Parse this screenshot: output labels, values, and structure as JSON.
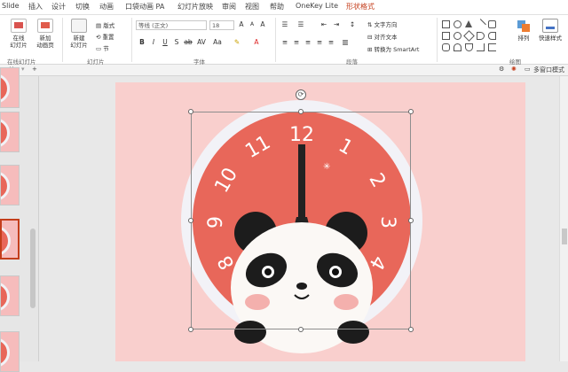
{
  "tabs": [
    {
      "label": "Slide",
      "active": false
    },
    {
      "label": "插入",
      "active": false
    },
    {
      "label": "设计",
      "active": false
    },
    {
      "label": "切换",
      "active": false
    },
    {
      "label": "动画",
      "active": false
    },
    {
      "label": "口袋动画 PA",
      "active": false
    },
    {
      "label": "幻灯片放映",
      "active": false
    },
    {
      "label": "审阅",
      "active": false
    },
    {
      "label": "视图",
      "active": false
    },
    {
      "label": "帮助",
      "active": false
    },
    {
      "label": "OneKey Lite",
      "active": false
    },
    {
      "label": "形状格式",
      "active": true
    }
  ],
  "ribbon": {
    "online_slide": "在线\n幻灯片",
    "new_animation": "新加\n动画页",
    "new_slide": "新建\n幻灯片",
    "layout": "版式",
    "reset": "重置",
    "section": "节",
    "font_name": "等线 (正文)",
    "font_size": "18",
    "text_direction": "文字方向",
    "align_text": "对齐文本",
    "smartart": "转换为 SmartArt",
    "arrange": "排列",
    "quick_styles": "快速样式",
    "groups": {
      "online": "在线幻灯片",
      "slides": "幻灯片",
      "font": "字体",
      "paragraph": "段落",
      "drawing": "绘图"
    }
  },
  "subbar": {
    "multi_window": "多窗口模式",
    "add_tab": "+"
  },
  "clock": {
    "numbers": [
      "12",
      "1",
      "2",
      "3",
      "4",
      "8",
      "9",
      "10",
      "11"
    ],
    "colors": {
      "face": "#e8675a",
      "rim": "#f2f2f7",
      "slide_bg": "#f9cfcd",
      "accent": "#c43e1c"
    }
  },
  "icons": [
    "close-icon",
    "rotate-handle-icon",
    "spark-icon",
    "settings-icon",
    "window-icon"
  ]
}
